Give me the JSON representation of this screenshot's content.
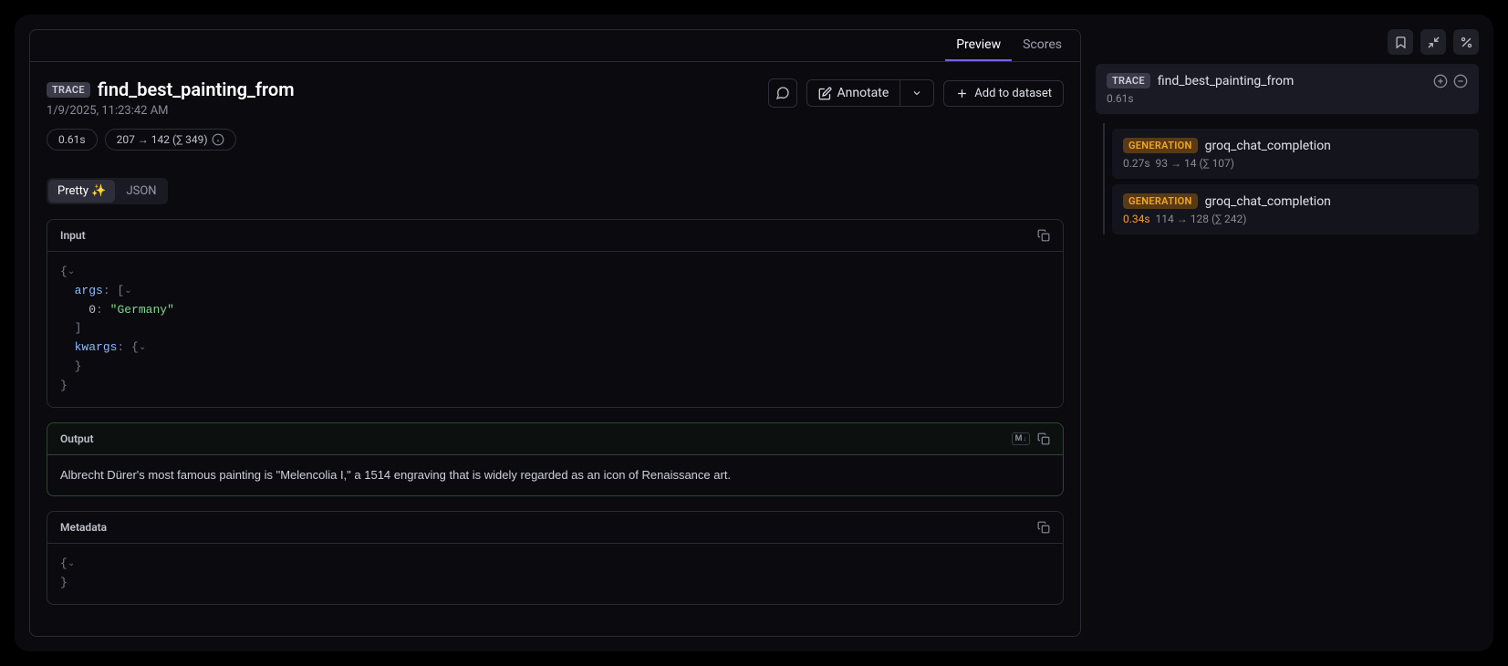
{
  "tabs": {
    "preview": "Preview",
    "scores": "Scores"
  },
  "header": {
    "badge": "TRACE",
    "name": "find_best_painting_from",
    "timestamp": "1/9/2025, 11:23:42 AM",
    "duration": "0.61s",
    "tokens": "207 → 142 (∑ 349)"
  },
  "actions": {
    "annotate": "Annotate",
    "add_dataset": "Add to dataset"
  },
  "view_toggle": {
    "pretty": "Pretty ✨",
    "json": "JSON"
  },
  "sections": {
    "input": {
      "label": "Input",
      "json": {
        "args_key": "args",
        "idx0": "0",
        "idx0_val": "\"Germany\"",
        "kwargs_key": "kwargs"
      }
    },
    "output": {
      "label": "Output",
      "text": "Albrecht Dürer's most famous painting is \"Melencolia I,\" a 1514 engraving that is widely regarded as an icon of Renaissance art."
    },
    "metadata": {
      "label": "Metadata"
    }
  },
  "side": {
    "root": {
      "badge": "TRACE",
      "name": "find_best_painting_from",
      "duration": "0.61s"
    },
    "children": [
      {
        "badge": "GENERATION",
        "name": "groq_chat_completion",
        "duration": "0.27s",
        "tokens": "93 → 14 (∑ 107)",
        "dur_orange": false
      },
      {
        "badge": "GENERATION",
        "name": "groq_chat_completion",
        "duration": "0.34s",
        "tokens": "114 → 128 (∑ 242)",
        "dur_orange": true
      }
    ]
  }
}
